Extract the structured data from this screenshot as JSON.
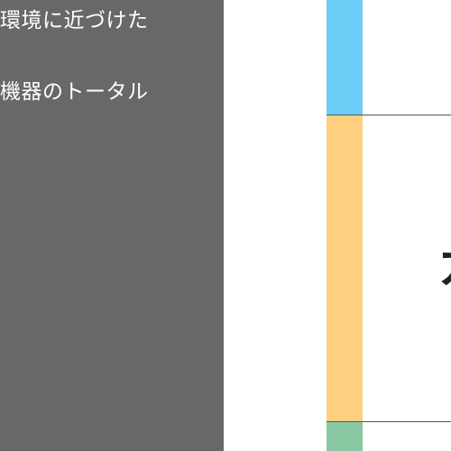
{
  "panel": {
    "lines": [
      "環境に近づけた",
      "機器のトータル"
    ]
  },
  "main": {
    "big_text": "ガ"
  },
  "colors": {
    "panel": "#676869",
    "blue": "#6ccdf6",
    "orange": "#fdcf7e",
    "green": "#88c9a3"
  }
}
